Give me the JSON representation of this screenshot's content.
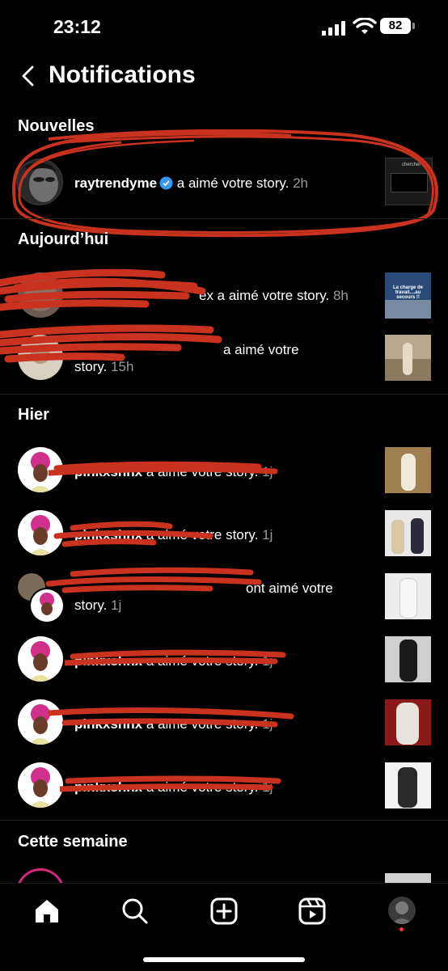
{
  "status": {
    "time": "23:12",
    "battery": "82"
  },
  "header": {
    "title": "Notifications"
  },
  "sections": {
    "new": "Nouvelles",
    "today": "Aujourd’hui",
    "yesterday": "Hier",
    "week": "Cette semaine"
  },
  "notifications": [
    {
      "user": "raytrendyme",
      "action": " a aimé votre story.",
      "time": " 2h",
      "verified": true
    },
    {
      "user": "",
      "action": "ex a aimé votre story.",
      "time": " 8h"
    },
    {
      "user": "",
      "action": "a aimé votre",
      "action2": "story.",
      "time": " 15h"
    },
    {
      "user": "pinkxshnx",
      "action": " a aimé votre story.",
      "time": " 1j"
    },
    {
      "user": "pinkxshnx",
      "action": " a aimé votre story.",
      "time": " 1j"
    },
    {
      "user": "",
      "action": "ont aimé votre",
      "action2": "story.",
      "time": " 1j"
    },
    {
      "user": "pinkxshnx",
      "action": " a aimé votre story.",
      "time": " 1j"
    },
    {
      "user": "pinkxshnx",
      "action": " a aimé votre story.",
      "time": " 1j"
    },
    {
      "user": "pinkxshnx",
      "action": " a aimé votre story.",
      "time": " 1j"
    }
  ],
  "thumbs": {
    "t1_title": "chercher",
    "t2_caption": "La charge de travail....au secours !!"
  },
  "tabs": [
    "home-icon",
    "search-icon",
    "create-icon",
    "reels-icon",
    "profile-icon"
  ],
  "colors": {
    "scribble": "#c8321e",
    "verified": "#3897f0",
    "notif_dot": "#ff3040"
  }
}
